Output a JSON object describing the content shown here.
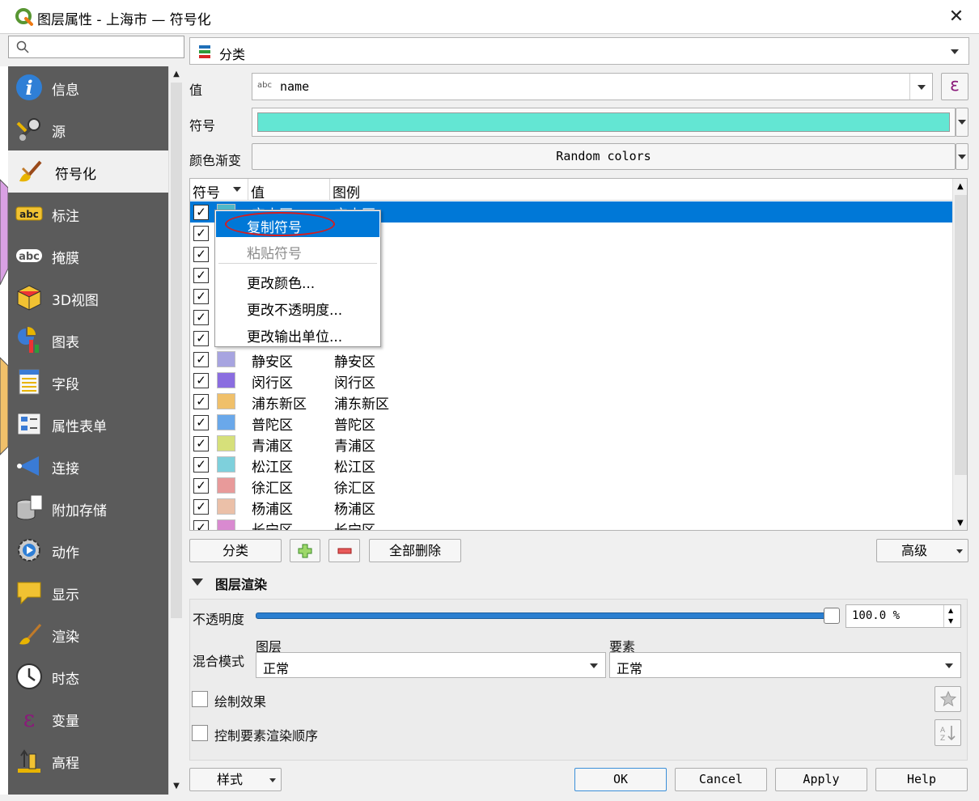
{
  "window": {
    "title": "图层属性 - 上海市 — 符号化",
    "close_glyph": "✕"
  },
  "search": {
    "placeholder": ""
  },
  "sidebar": {
    "items": [
      {
        "label": "信息",
        "icon": "info-icon"
      },
      {
        "label": "源",
        "icon": "source-icon"
      },
      {
        "label": "符号化",
        "icon": "paint-brush-icon",
        "active": true
      },
      {
        "label": "标注",
        "icon": "label-abc-icon"
      },
      {
        "label": "掩膜",
        "icon": "mask-abc-icon"
      },
      {
        "label": "3D视图",
        "icon": "cube-3d-icon"
      },
      {
        "label": "图表",
        "icon": "diagram-icon"
      },
      {
        "label": "字段",
        "icon": "fields-icon"
      },
      {
        "label": "属性表单",
        "icon": "form-icon"
      },
      {
        "label": "连接",
        "icon": "join-icon"
      },
      {
        "label": "附加存储",
        "icon": "storage-icon"
      },
      {
        "label": "动作",
        "icon": "action-gear-icon"
      },
      {
        "label": "显示",
        "icon": "display-bubble-icon"
      },
      {
        "label": "渲染",
        "icon": "render-brush-icon"
      },
      {
        "label": "时态",
        "icon": "clock-icon"
      },
      {
        "label": "变量",
        "icon": "epsilon-icon"
      },
      {
        "label": "高程",
        "icon": "elevation-icon"
      }
    ]
  },
  "renderer": {
    "type_label": "分类"
  },
  "value": {
    "label": "值",
    "abc": "abc",
    "field": "name",
    "expr_glyph": "ε"
  },
  "symbol": {
    "label": "符号",
    "color": "#63e6d3"
  },
  "ramp": {
    "label": "颜色渐变",
    "value": "Random colors"
  },
  "table": {
    "headers": {
      "symbol": "符号",
      "value": "值",
      "legend": "图例"
    },
    "rows": [
      {
        "value": "宝山区",
        "legend": "宝山区",
        "color": "#4fb8c8",
        "selected": true
      },
      {
        "value": "",
        "legend": "",
        "color": "#8bd18a"
      },
      {
        "value": "",
        "legend": "",
        "color": "#e59ab8"
      },
      {
        "value": "",
        "legend": "",
        "color": "#b9e07a"
      },
      {
        "value": "",
        "legend": "",
        "color": "#e7b06a"
      },
      {
        "value": "",
        "legend": "",
        "color": "#8fb7e8"
      },
      {
        "value": "",
        "legend": "",
        "color": "#6cc6b0"
      },
      {
        "value": "静安区",
        "legend": "静安区",
        "color": "#a7a4e0"
      },
      {
        "value": "闵行区",
        "legend": "闵行区",
        "color": "#8a6de0"
      },
      {
        "value": "浦东新区",
        "legend": "浦东新区",
        "color": "#f0c06a"
      },
      {
        "value": "普陀区",
        "legend": "普陀区",
        "color": "#6aa8ea"
      },
      {
        "value": "青浦区",
        "legend": "青浦区",
        "color": "#d6e07a"
      },
      {
        "value": "松江区",
        "legend": "松江区",
        "color": "#7ed0dc"
      },
      {
        "value": "徐汇区",
        "legend": "徐汇区",
        "color": "#e89a9a"
      },
      {
        "value": "杨浦区",
        "legend": "杨浦区",
        "color": "#ebc0a8"
      },
      {
        "value": "长宁区",
        "legend": "长宁区",
        "color": "#d98ad0"
      }
    ]
  },
  "context_menu": {
    "items": [
      {
        "label": "复制符号",
        "state": "highlighted"
      },
      {
        "label": "粘贴符号",
        "state": "disabled"
      },
      {
        "label": "更改颜色...",
        "state": "normal"
      },
      {
        "label": "更改不透明度...",
        "state": "normal"
      },
      {
        "label": "更改输出单位...",
        "state": "normal"
      }
    ]
  },
  "buttons": {
    "classify": "分类",
    "delete_all": "全部删除",
    "advanced": "高级",
    "style": "样式",
    "ok": "OK",
    "cancel": "Cancel",
    "apply": "Apply",
    "help": "Help"
  },
  "layer_rendering": {
    "title": "图层渲染",
    "opacity_label": "不透明度",
    "opacity_value": "100.0 %",
    "opacity_level": 1.0,
    "blend_label": "混合模式",
    "layer_label": "图层",
    "layer_value": "正常",
    "feature_label": "要素",
    "feature_value": "正常",
    "draw_effects": "绘制效果",
    "control_order": "控制要素渲染顺序"
  }
}
